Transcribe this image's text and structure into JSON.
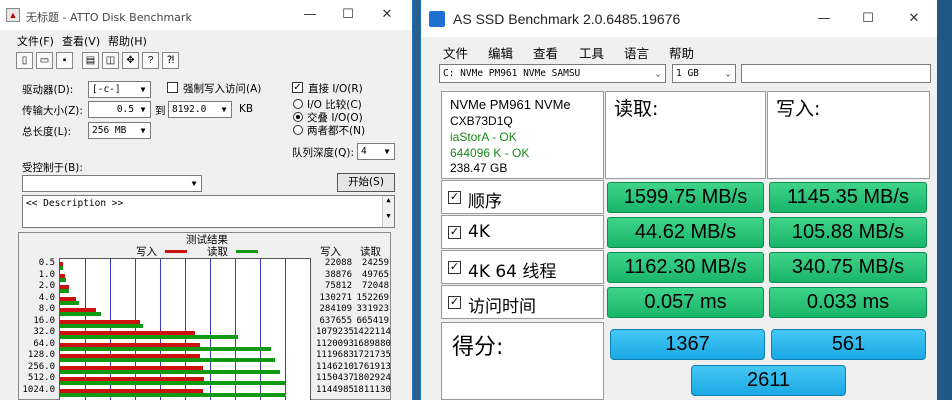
{
  "atto": {
    "title": "无标题 - ATTO Disk Benchmark",
    "menu": [
      "文件(F)",
      "查看(V)",
      "帮助(H)"
    ],
    "toolbar_icons": [
      "new-icon",
      "open-icon",
      "save-icon",
      "print-icon",
      "print-preview-icon",
      "move-icon",
      "help-icon",
      "context-help-icon"
    ],
    "drive_label": "驱动器(D):",
    "drive_value": "[-c-]",
    "transfer_label": "传输大小(Z):",
    "transfer_from": "0.5",
    "transfer_to_label": "到",
    "transfer_to": "8192.0",
    "transfer_unit": "KB",
    "total_label": "总长度(L):",
    "total_value": "256 MB",
    "force_write": "强制写入访问(A)",
    "direct_io": "直接 I/O(R)",
    "io_compare": "I/O 比较(C)",
    "io_overlap": "交叠 I/O(O)",
    "neither": "两者都不(N)",
    "queue_label": "队列深度(Q):",
    "queue_value": "4",
    "controlled_label": "受控制于(B):",
    "start_button": "开始(S)",
    "description": "<< Description >>",
    "results": {
      "title": "测试结果",
      "legend_write": "写入",
      "legend_read": "读取",
      "col_write": "写入",
      "col_read": "读取",
      "sizes": [
        "0.5",
        "1.0",
        "2.0",
        "4.0",
        "8.0",
        "16.0",
        "32.0",
        "64.0",
        "128.0",
        "256.0",
        "512.0",
        "1024.0"
      ],
      "write": [
        "22088",
        "38876",
        "75812",
        "130271",
        "284109",
        "637655",
        "1079235",
        "1120093",
        "1119683",
        "1146210",
        "1150437",
        "1144985"
      ],
      "read": [
        "24259",
        "49765",
        "72048",
        "152269",
        "331923",
        "665419",
        "1422114",
        "1689880",
        "1721735",
        "1761913",
        "1802924",
        "1811130"
      ]
    },
    "chart_data": {
      "type": "bar",
      "title": "测试结果",
      "categories": [
        "0.5",
        "1.0",
        "2.0",
        "4.0",
        "8.0",
        "16.0",
        "32.0",
        "64.0",
        "128.0",
        "256.0",
        "512.0",
        "1024.0"
      ],
      "series": [
        {
          "name": "写入",
          "color": "#cc1111",
          "values": [
            22088,
            38876,
            75812,
            130271,
            284109,
            637655,
            1079235,
            1120093,
            1119683,
            1146210,
            1150437,
            1144985
          ]
        },
        {
          "name": "读取",
          "color": "#119911",
          "values": [
            24259,
            49765,
            72048,
            152269,
            331923,
            665419,
            1422114,
            1689880,
            1721735,
            1761913,
            1802924,
            1811130
          ]
        }
      ],
      "xlim": [
        0,
        2000000
      ],
      "gridlines": 10
    }
  },
  "asssd": {
    "title": "AS SSD Benchmark 2.0.6485.19676",
    "menu": [
      "文件",
      "编辑",
      "查看",
      "工具",
      "语言",
      "帮助"
    ],
    "drive_select": "C: NVMe PM961 NVMe SAMSU",
    "size_select": "1 GB",
    "drive_info": {
      "model": "NVMe PM961 NVMe",
      "firmware": "CXB73D1Q",
      "driver": "iaStorA - OK",
      "alignment": "644096 K - OK",
      "capacity": "238.47 GB"
    },
    "read_header": "读取:",
    "write_header": "写入:",
    "rows": [
      {
        "label": "顺序",
        "read": "1599.75 MB/s",
        "write": "1145.35 MB/s"
      },
      {
        "label": "4K",
        "read": "44.62 MB/s",
        "write": "105.88 MB/s"
      },
      {
        "label": "4K 64 线程",
        "read": "1162.30 MB/s",
        "write": "340.75 MB/s"
      },
      {
        "label": "访问时间",
        "read": "0.057 ms",
        "write": "0.033 ms"
      }
    ],
    "score_label": "得分:",
    "score_read": "1367",
    "score_write": "561",
    "score_total": "2611",
    "info_color": "#1a8a1a",
    "bar_color": "#19b56a",
    "score_color": "#1aa8e4"
  }
}
